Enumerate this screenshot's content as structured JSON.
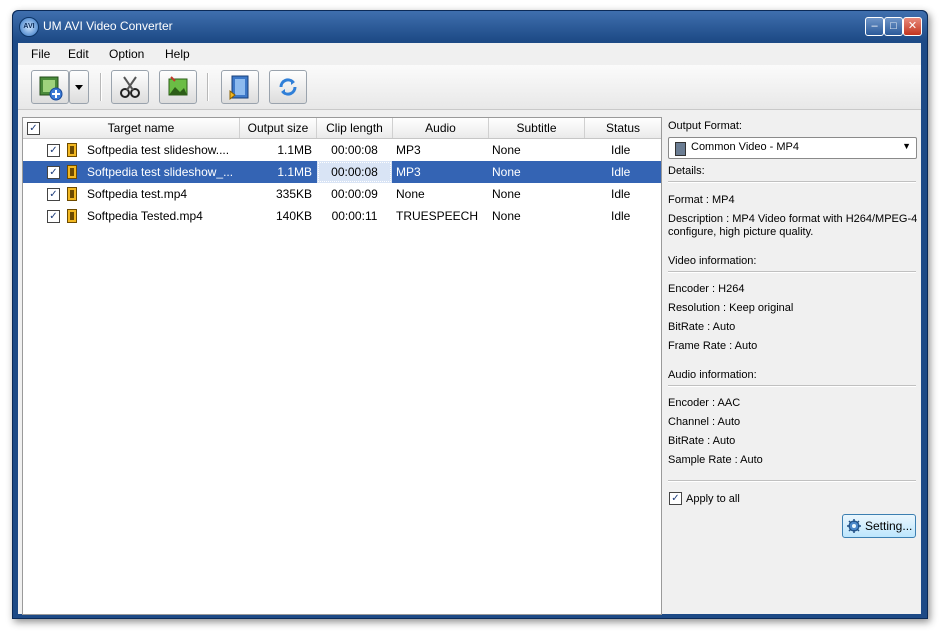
{
  "window": {
    "title": "UM AVI Video Converter",
    "app_icon_text": "AVI"
  },
  "menu": [
    "File",
    "Edit",
    "Option",
    "Help"
  ],
  "table": {
    "columns": [
      "Target name",
      "Output size",
      "Clip length",
      "Audio",
      "Subtitle",
      "Status"
    ],
    "rows": [
      {
        "name": "Softpedia test slideshow....",
        "size": "1.1MB",
        "length": "00:00:08",
        "audio": "MP3",
        "subtitle": "None",
        "status": "Idle",
        "checked": true,
        "selected": false
      },
      {
        "name": "Softpedia test slideshow_...",
        "size": "1.1MB",
        "length": "00:00:08",
        "audio": "MP3",
        "subtitle": "None",
        "status": "Idle",
        "checked": true,
        "selected": true
      },
      {
        "name": "Softpedia test.mp4",
        "size": "335KB",
        "length": "00:00:09",
        "audio": "None",
        "subtitle": "None",
        "status": "Idle",
        "checked": true,
        "selected": false
      },
      {
        "name": "Softpedia Tested.mp4",
        "size": "140KB",
        "length": "00:00:11",
        "audio": "TRUESPEECH",
        "subtitle": "None",
        "status": "Idle",
        "checked": true,
        "selected": false
      }
    ]
  },
  "panel": {
    "output_format_label": "Output Format:",
    "output_format_value": "Common Video - MP4",
    "details_label": "Details:",
    "format_line": "Format     : MP4",
    "description_line1": "Description : MP4 Video format with H264/MPEG-4",
    "description_line2": "configure, high picture quality.",
    "video_info_label": "Video information:",
    "video": [
      "Encoder      : H264",
      "Resolution  : Keep original",
      "BitRate     : Auto",
      "Frame Rate  : Auto"
    ],
    "audio_info_label": "Audio information:",
    "audio": [
      "Encoder      : AAC",
      "Channel      : Auto",
      "BitRate       : Auto",
      "Sample Rate : Auto"
    ],
    "apply_all_label": "Apply to all",
    "apply_all_checked": true,
    "settings_button": "Setting..."
  },
  "icons": [
    "add-video-icon",
    "dropdown-arrow-icon",
    "scissors-icon",
    "crop-icon",
    "convert-film-icon",
    "refresh-icon",
    "gear-icon",
    "film-icon",
    "checkbox-icon"
  ],
  "colors": {
    "titlebar": "#1d4a86",
    "selection": "#3464b4",
    "background": "#f0f0f0"
  }
}
